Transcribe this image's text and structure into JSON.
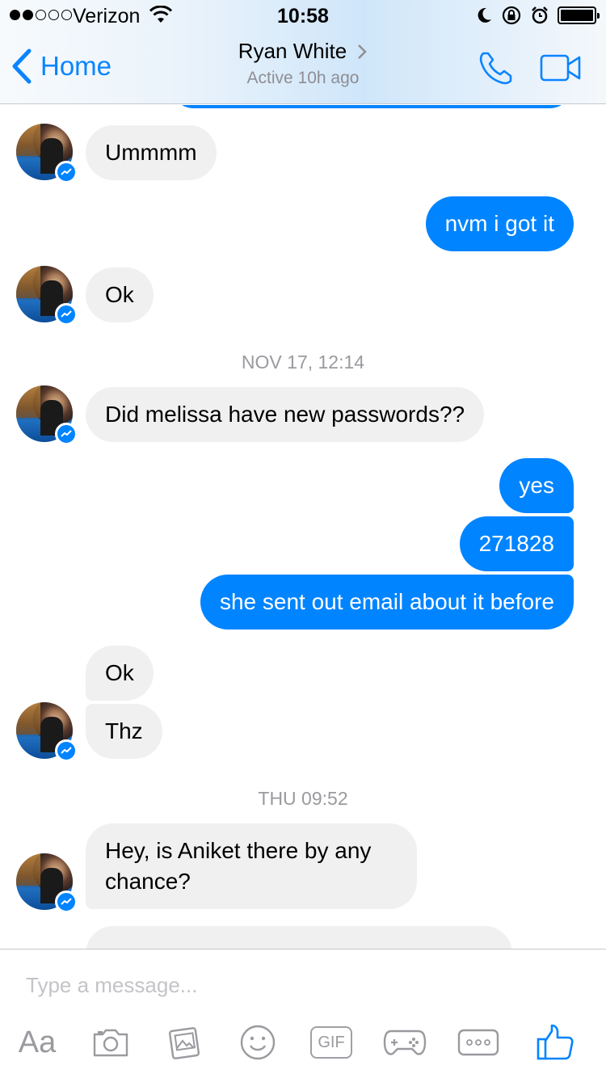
{
  "status_bar": {
    "signal_dots_filled": 2,
    "signal_dots_total": 5,
    "carrier": "Verizon",
    "time": "10:58",
    "battery_level": 1.0
  },
  "header": {
    "back_label": "Home",
    "contact_name": "Ryan White",
    "presence": "Active 10h ago",
    "accent_color": "#0a84ff"
  },
  "conversation": {
    "messages": [
      {
        "id": "m1",
        "direction": "incoming",
        "text": "Ummmm"
      },
      {
        "id": "m2",
        "direction": "outgoing",
        "text": "nvm i got it"
      },
      {
        "id": "m3",
        "direction": "incoming",
        "text": "Ok"
      },
      {
        "id": "t1",
        "type": "timestamp",
        "text": "NOV 17, 12:14"
      },
      {
        "id": "m4",
        "direction": "incoming",
        "text": "Did melissa have new passwords??"
      },
      {
        "id": "m5",
        "direction": "outgoing",
        "text": "yes"
      },
      {
        "id": "m6",
        "direction": "outgoing",
        "text": "271828"
      },
      {
        "id": "m7",
        "direction": "outgoing",
        "text": "she sent out email about it before"
      },
      {
        "id": "m8",
        "direction": "incoming",
        "text": "Ok"
      },
      {
        "id": "m9",
        "direction": "incoming",
        "text": "Thz"
      },
      {
        "id": "t2",
        "type": "timestamp",
        "text": "THU 09:52"
      },
      {
        "id": "m10",
        "direction": "incoming",
        "text": "Hey, is Aniket there by any chance?"
      }
    ],
    "incoming_bubble_color": "#f1f0f0",
    "outgoing_bubble_color": "#0084ff"
  },
  "composer": {
    "placeholder": "Type a message...",
    "value": "",
    "tools": [
      {
        "icon": "text-size-icon",
        "label": "Aa"
      },
      {
        "icon": "camera-icon"
      },
      {
        "icon": "gallery-icon"
      },
      {
        "icon": "emoji-icon"
      },
      {
        "icon": "gif-icon",
        "label": "GIF"
      },
      {
        "icon": "games-icon"
      },
      {
        "icon": "more-icon"
      },
      {
        "icon": "thumbs-up-icon"
      }
    ]
  }
}
